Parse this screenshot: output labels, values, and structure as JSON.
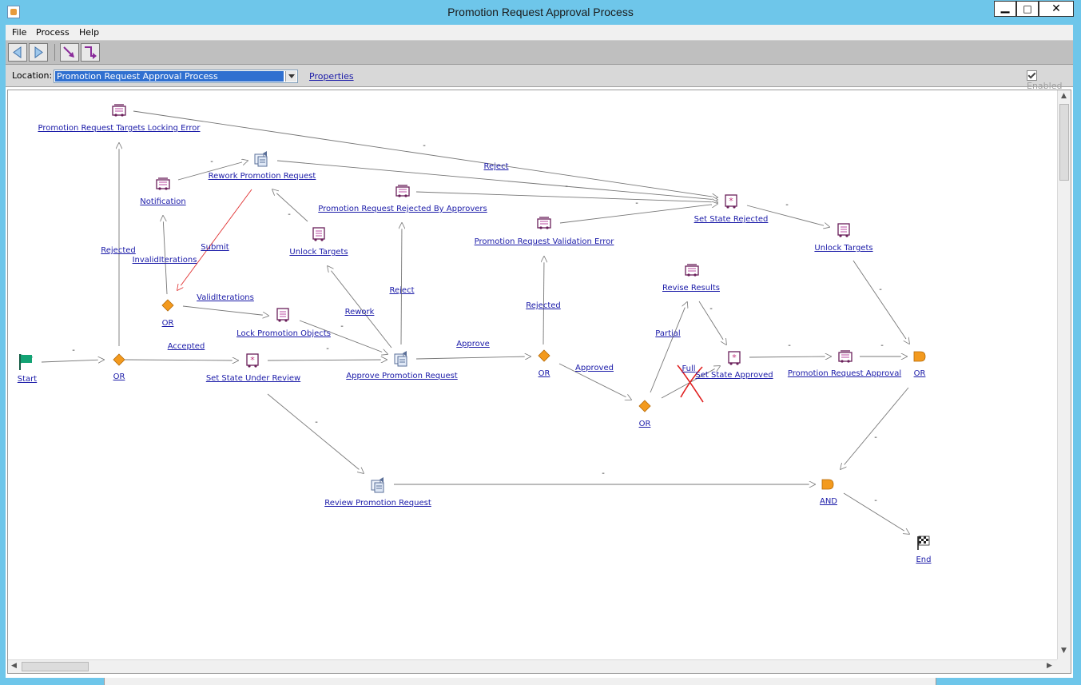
{
  "window": {
    "title": "Promotion Request Approval Process",
    "minimize": "▁",
    "maximize": "□",
    "close": "✕"
  },
  "menu": {
    "file": "File",
    "process": "Process",
    "help": "Help"
  },
  "location": {
    "label": "Location:",
    "value": "Promotion Request Approval Process",
    "properties": "Properties",
    "enabled": "Enabled"
  },
  "nodes": {
    "targets_lock_error": "Promotion Request Targets Locking Error",
    "notification": "Notification",
    "rework_request": "Rework Promotion Request",
    "rejected_by_approvers": "Promotion Request Rejected By Approvers",
    "validation_error": "Promotion Request Validation Error",
    "set_state_rejected": "Set State Rejected",
    "unlock_targets_right": "Unlock Targets",
    "unlock_targets_mid": "Unlock Targets",
    "revise_results": "Revise Results",
    "or_iterations": "OR",
    "lock_objects": "Lock Promotion Objects",
    "start": "Start",
    "or_start": "OR",
    "set_state_under_review": "Set State Under Review",
    "approve_request": "Approve Promotion Request",
    "or_approve": "OR",
    "or_approved": "OR",
    "set_state_approved": "Set State Approved",
    "request_approval": "Promotion Request Approval",
    "or_final": "OR",
    "review_request": "Review Promotion Request",
    "and_join": "AND",
    "end": "End"
  },
  "edges": {
    "rejected_left": "Rejected",
    "invalid_iterations": "InvalidIterations",
    "submit": "Submit",
    "valid_iterations": "ValidIterations",
    "accepted": "Accepted",
    "rework": "Rework",
    "reject_up": "Reject",
    "reject_top": "Reject",
    "approve": "Approve",
    "rejected_mid": "Rejected",
    "approved": "Approved",
    "partial": "Partial",
    "full": "Full",
    "dash": "-"
  }
}
